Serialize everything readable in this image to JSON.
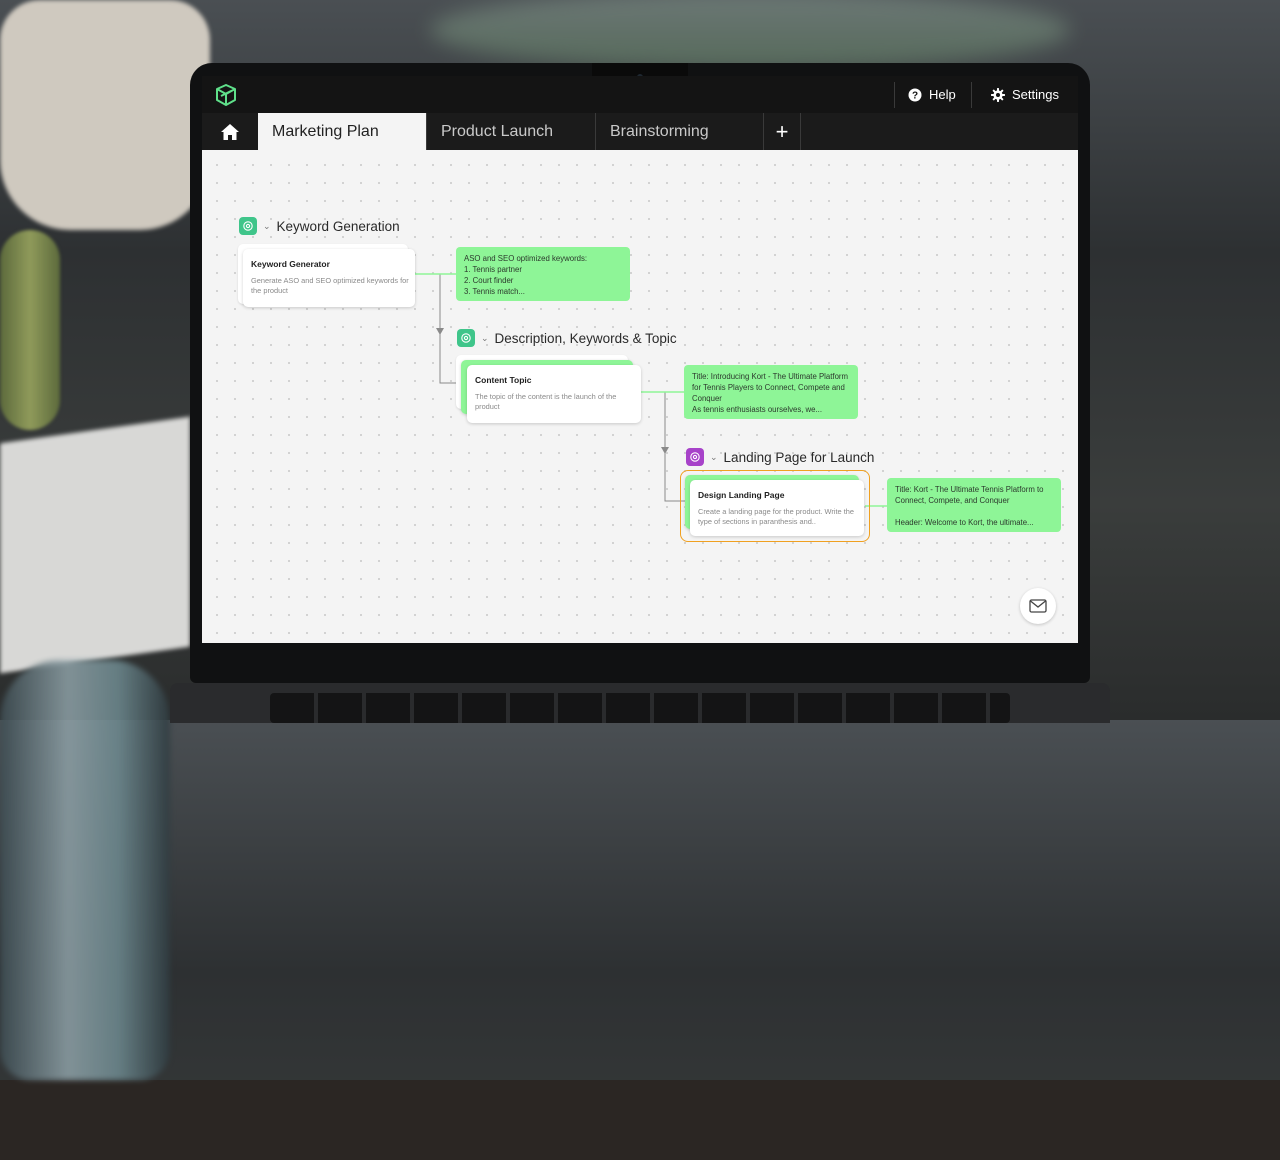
{
  "window": {
    "help_label": "Help",
    "settings_label": "Settings"
  },
  "tabs": [
    {
      "label": "Marketing Plan",
      "active": true
    },
    {
      "label": "Product Launch",
      "active": false
    },
    {
      "label": "Brainstorming",
      "active": false
    }
  ],
  "colors": {
    "accent_green": "#8ef597",
    "openai_green": "#3fc58a",
    "purple": "#a742c9",
    "selection_orange": "#f0a020"
  },
  "groups": [
    {
      "title": "Keyword Generation",
      "icon": "openai-icon",
      "card": {
        "title": "Keyword Generator",
        "description": "Generate ASO and SEO optimized keywords for the product"
      },
      "output": "ASO and SEO optimized keywords:\n1. Tennis partner\n2. Court finder\n3. Tennis match..."
    },
    {
      "title": "Description, Keywords & Topic",
      "icon": "openai-icon",
      "card": {
        "title": "Content Topic",
        "description": "The topic of the content is the launch of the product"
      },
      "output": "Title: Introducing Kort - The Ultimate Platform for Tennis Players to Connect, Compete and Conquer\nAs tennis enthusiasts ourselves, we..."
    },
    {
      "title": "Landing Page for Launch",
      "icon": "openai-icon",
      "card": {
        "title": "Design Landing Page",
        "description": "Create a landing page for the product. Write the type of sections in paranthesis and.."
      },
      "output": "Title: Kort - The Ultimate Tennis Platform to Connect, Compete, and Conquer\n\nHeader: Welcome to Kort, the ultimate..."
    }
  ]
}
